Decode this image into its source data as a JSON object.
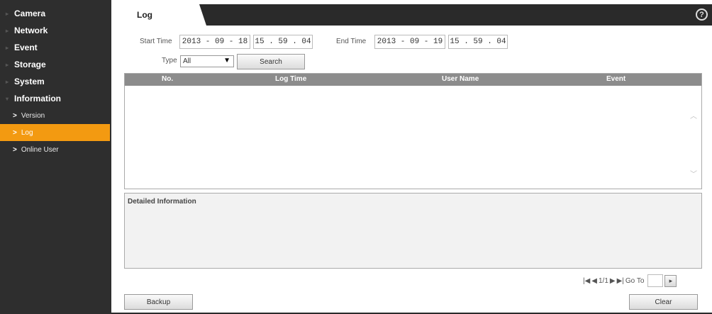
{
  "sidebar": {
    "items": [
      {
        "label": "Camera"
      },
      {
        "label": "Network"
      },
      {
        "label": "Event"
      },
      {
        "label": "Storage"
      },
      {
        "label": "System"
      },
      {
        "label": "Information"
      }
    ],
    "sub_items": [
      {
        "label": "Version",
        "active": false
      },
      {
        "label": "Log",
        "active": true
      },
      {
        "label": "Online User",
        "active": false
      }
    ]
  },
  "tab": {
    "label": "Log"
  },
  "help": {
    "symbol": "?"
  },
  "filter": {
    "start_time_label": "Start Time",
    "start_date": "2013 - 09 - 18",
    "start_clock": "15 . 59 . 04",
    "end_time_label": "End Time",
    "end_date": "2013 - 09 - 19",
    "end_clock": "15 . 59 . 04",
    "type_label": "Type",
    "type_value": "All",
    "search_label": "Search"
  },
  "table": {
    "columns": [
      "No.",
      "Log Time",
      "User Name",
      "Event"
    ],
    "rows": []
  },
  "detail": {
    "title": "Detailed Information"
  },
  "pager": {
    "first": "◀",
    "prev": "◀",
    "page_info": "1/1",
    "next": "▶",
    "last": "▶",
    "goto_label": "Go To"
  },
  "buttons": {
    "backup": "Backup",
    "clear": "Clear"
  },
  "colors": {
    "active": "#f39a11",
    "sidebar": "#2e2e2e",
    "header": "#8c8c8c"
  }
}
